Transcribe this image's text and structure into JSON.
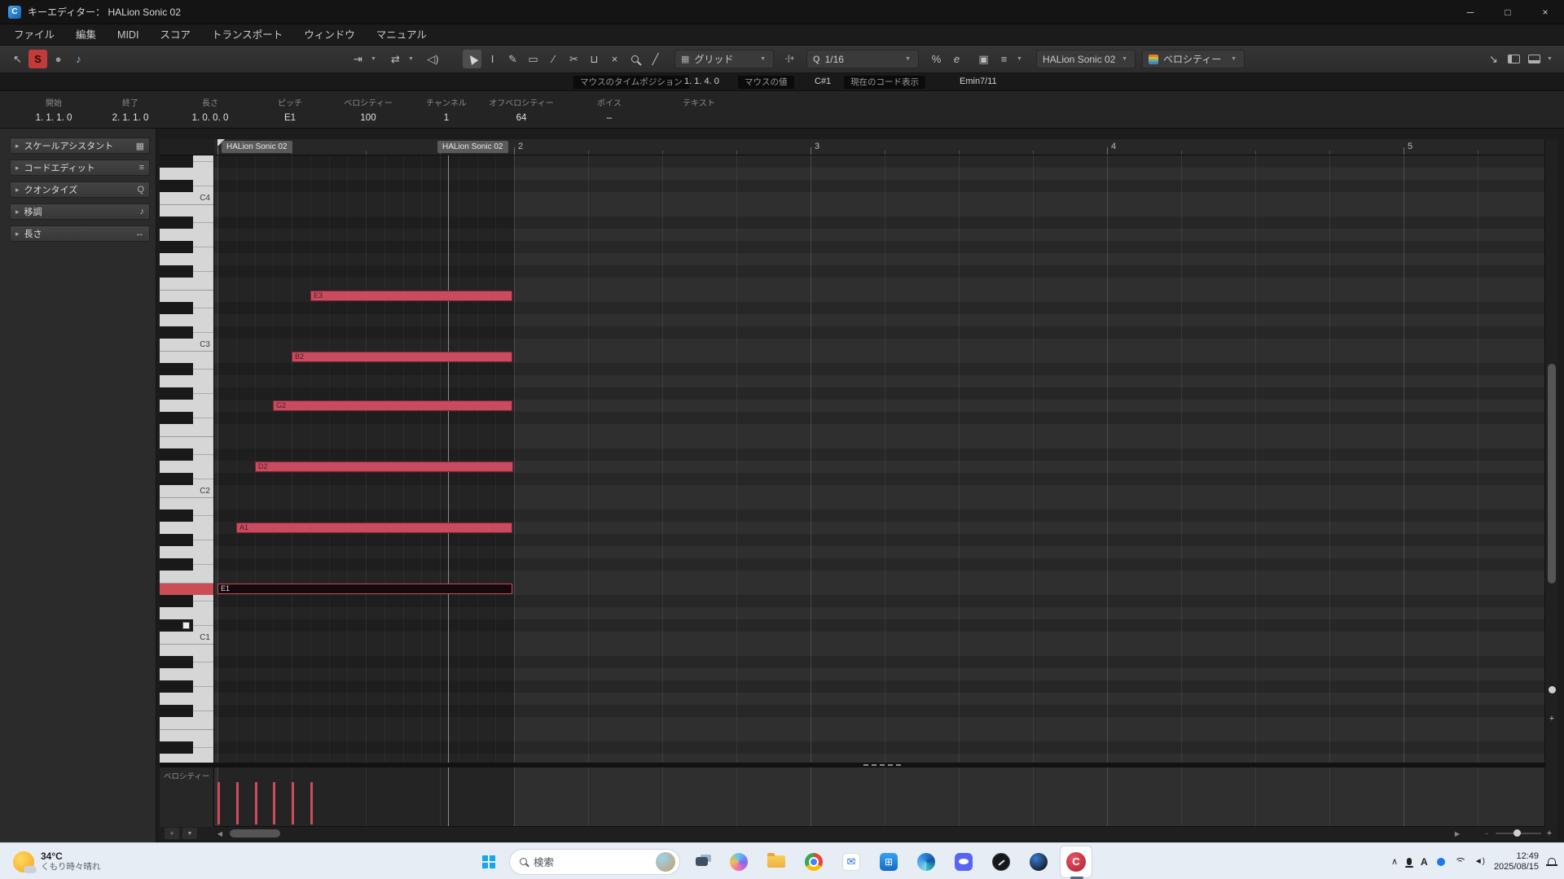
{
  "window": {
    "title": "キーエディター： HALion Sonic 02"
  },
  "menu": {
    "items": [
      "ファイル",
      "編集",
      "MIDI",
      "スコア",
      "トランスポート",
      "ウィンドウ",
      "マニュアル"
    ]
  },
  "icons": {
    "pin": "↖",
    "solo": "S",
    "record": "●",
    "feedback": "♪",
    "autoscroll": "⇥",
    "arrows": "⇄",
    "speaker": "◁)",
    "range": "I",
    "draw": "✎",
    "erase": "▭",
    "trim": "∕",
    "split": "✂",
    "glue": "⊔",
    "mute": "×",
    "line": "╱",
    "grid": "▦",
    "nudge": "-|+",
    "quantize_q": "Q",
    "swing": "%",
    "edit_q": "e",
    "part": "▣",
    "stack": "≡",
    "diag": "↘",
    "caret": "▼",
    "minimize": "─",
    "maximize": "□",
    "close": "×",
    "scroll_left": "◀",
    "scroll_right": "▶",
    "plus": "+",
    "minus": "−",
    "lane_plus": "+",
    "lane_caret": "▼",
    "chevron_up": "∧",
    "volume": "◄)"
  },
  "toolbar": {
    "grid_label": "グリッド",
    "quantize_value": "1/16",
    "part_selector": "HALion Sonic 02",
    "lane_selector": "ベロシティー"
  },
  "statusline": {
    "mouse_time_label": "マウスのタイムポジション",
    "mouse_time_value": "1. 1. 4. 0",
    "mouse_value_label": "マウスの値",
    "mouse_value_value": "C#1",
    "chord_label": "現在のコード表示",
    "chord_value": "Emin7/11"
  },
  "infoline": {
    "fields": [
      {
        "label": "開始",
        "value": "1. 1. 1. 0"
      },
      {
        "label": "終了",
        "value": "2. 1. 1. 0"
      },
      {
        "label": "長さ",
        "value": "1. 0. 0. 0"
      },
      {
        "label": "ピッチ",
        "value": "E1"
      },
      {
        "label": "ベロシティー",
        "value": "100"
      },
      {
        "label": "チャンネル",
        "value": "1"
      },
      {
        "label": "オフベロシティー",
        "value": "64"
      },
      {
        "label": "ボイス",
        "value": "–"
      },
      {
        "label": "テキスト",
        "value": ""
      }
    ]
  },
  "sidebar": {
    "panels": [
      {
        "label": "スケールアシスタント",
        "icon": "▦",
        "icon_name": "keyboard-icon"
      },
      {
        "label": "コードエディット",
        "icon": "≡",
        "icon_name": "list-icon"
      },
      {
        "label": "クオンタイズ",
        "icon": "Q",
        "icon_name": "quantize-icon"
      },
      {
        "label": "移調",
        "icon": "♪",
        "icon_name": "note-icon"
      },
      {
        "label": "長さ",
        "icon": "↔",
        "icon_name": "length-icon"
      }
    ]
  },
  "ruler": {
    "bars": [
      "2",
      "3",
      "4",
      "5"
    ]
  },
  "part": {
    "name": "HALion Sonic 02"
  },
  "piano": {
    "c_labels": [
      {
        "label": "C4",
        "midi": 72
      },
      {
        "label": "C3",
        "midi": 60
      },
      {
        "label": "C2",
        "midi": 48
      },
      {
        "label": "C1",
        "midi": 36
      }
    ]
  },
  "notes": [
    {
      "label": "E3",
      "midi": 64,
      "start": 5,
      "end": 16,
      "selected": false
    },
    {
      "label": "B2",
      "midi": 59,
      "start": 4,
      "end": 16,
      "selected": false
    },
    {
      "label": "G2",
      "midi": 55,
      "start": 3,
      "end": 16,
      "selected": false
    },
    {
      "label": "D2",
      "midi": 50,
      "start": 2,
      "end": 16,
      "selected": false
    },
    {
      "label": "A1",
      "midi": 45,
      "start": 1,
      "end": 16,
      "selected": false
    },
    {
      "label": "E1",
      "midi": 40,
      "start": 0,
      "end": 16,
      "selected": true
    }
  ],
  "velocity_lane": {
    "label": "ベロシティー",
    "stems": [
      {
        "pos16": 0,
        "value": 100
      },
      {
        "pos16": 1,
        "value": 100
      },
      {
        "pos16": 2,
        "value": 100
      },
      {
        "pos16": 3,
        "value": 100
      },
      {
        "pos16": 4,
        "value": 100
      },
      {
        "pos16": 5,
        "value": 100
      }
    ]
  },
  "colors": {
    "note": "#c94b60",
    "selected_note_border": "#c94b60",
    "key_highlight": "#cb4e57",
    "solo_button": "#c23a3a",
    "taskbar": "#e7edf4"
  },
  "taskbar": {
    "weather": {
      "temp": "34°C",
      "desc": "くもり時々晴れ"
    },
    "search": {
      "placeholder": "検索"
    },
    "ime": "A",
    "clock": {
      "time": "12:49",
      "date": "2025/08/15"
    }
  }
}
